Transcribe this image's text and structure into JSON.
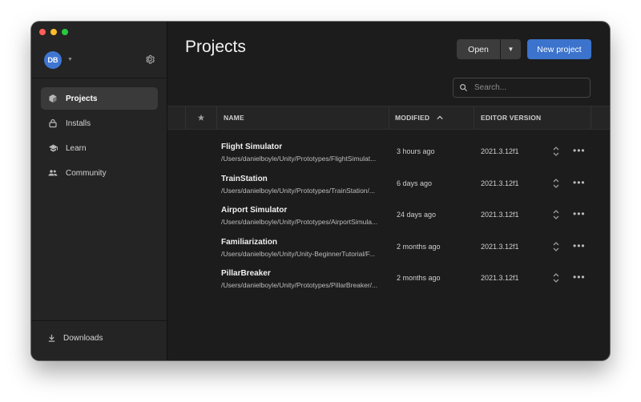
{
  "user": {
    "initials": "DB"
  },
  "sidebar": {
    "items": [
      {
        "label": "Projects",
        "icon": "cube-icon",
        "active": true
      },
      {
        "label": "Installs",
        "icon": "lock-icon"
      },
      {
        "label": "Learn",
        "icon": "graduation-cap-icon"
      },
      {
        "label": "Community",
        "icon": "people-icon"
      }
    ],
    "downloads_label": "Downloads"
  },
  "main": {
    "title": "Projects",
    "open_label": "Open",
    "new_label": "New project",
    "search_placeholder": "Search..."
  },
  "table": {
    "headers": {
      "name": "NAME",
      "modified": "MODIFIED",
      "editor": "EDITOR VERSION"
    },
    "rows": [
      {
        "name": "Flight Simulator",
        "path": "/Users/danielboyle/Unity/Prototypes/FlightSimulat...",
        "modified": "3 hours ago",
        "version": "2021.3.12f1"
      },
      {
        "name": "TrainStation",
        "path": "/Users/danielboyle/Unity/Prototypes/TrainStation/...",
        "modified": "6 days ago",
        "version": "2021.3.12f1"
      },
      {
        "name": "Airport Simulator",
        "path": "/Users/danielboyle/Unity/Prototypes/AirportSimula...",
        "modified": "24 days ago",
        "version": "2021.3.12f1"
      },
      {
        "name": "Familiarization",
        "path": "/Users/danielboyle/Unity/Unity-BeginnerTutorial/F...",
        "modified": "2 months ago",
        "version": "2021.3.12f1"
      },
      {
        "name": "PillarBreaker",
        "path": "/Users/danielboyle/Unity/Prototypes/PillarBreaker/...",
        "modified": "2 months ago",
        "version": "2021.3.12f1"
      }
    ]
  },
  "colors": {
    "accent": "#3b73cd",
    "traffic_close": "#ff5f57",
    "traffic_minimize": "#febc2e",
    "traffic_maximize": "#28c840"
  }
}
